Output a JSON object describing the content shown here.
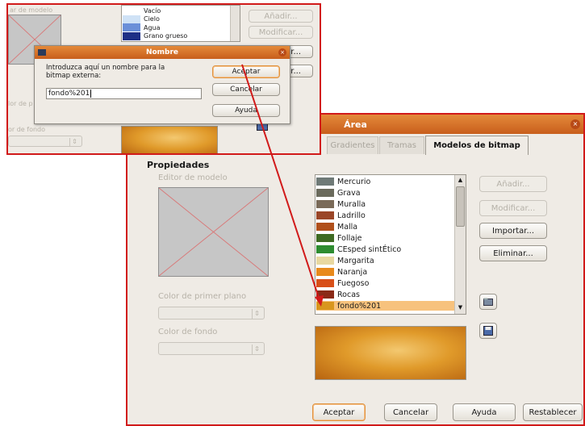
{
  "top_window": {
    "list_items": [
      {
        "label": "Vacío",
        "color": "#ffffff"
      },
      {
        "label": "Cielo",
        "color": "#cfe2f6"
      },
      {
        "label": "Agua",
        "color": "#6a8fd8"
      },
      {
        "label": "Grano grueso",
        "color": "#1e2f86"
      }
    ],
    "editor_label": "ar de modelo",
    "side_buttons": [
      "Añadir...",
      "Modificar...",
      "ortar...",
      "inar..."
    ],
    "left_labels": [
      "lor de p",
      "or de fondo"
    ],
    "dialog": {
      "title": "Nombre",
      "prompt": "Introduzca aquí un nombre para la bitmap externa:",
      "input_value": "fondo%201",
      "accept": "Aceptar",
      "cancel": "Cancelar",
      "help": "Ayuda"
    }
  },
  "area_dialog": {
    "title": "Área",
    "tabs": [
      {
        "label": "Gradientes",
        "active": false
      },
      {
        "label": "Tramas",
        "active": false
      },
      {
        "label": "Modelos de bitmap",
        "active": true
      }
    ],
    "section_label": "Propiedades",
    "editor_label": "Editor de modelo",
    "fg_color_label": "Color de primer plano",
    "bg_color_label": "Color de fondo",
    "bitmaps": [
      {
        "label": "Mercurio",
        "color": "#6f7a77"
      },
      {
        "label": "Grava",
        "color": "#6a6a5c"
      },
      {
        "label": "Muralla",
        "color": "#7a6a58"
      },
      {
        "label": "Ladrillo",
        "color": "#9a4628"
      },
      {
        "label": "Malla",
        "color": "#b0501c"
      },
      {
        "label": "Follaje",
        "color": "#3e6a22"
      },
      {
        "label": "CEsped sintÉtico",
        "color": "#2e8c30"
      },
      {
        "label": "Margarita",
        "color": "#e8d8a0"
      },
      {
        "label": "Naranja",
        "color": "#e88a1c"
      },
      {
        "label": "Fuegoso",
        "color": "#d8501a"
      },
      {
        "label": "Rocas",
        "color": "#8a2a18"
      },
      {
        "label": "fondo%201",
        "color": "#d8961e",
        "selected": true
      }
    ],
    "buttons": {
      "add": "Añadir...",
      "modify": "Modificar...",
      "import": "Importar...",
      "delete": "Eliminar..."
    },
    "footer": {
      "accept": "Aceptar",
      "cancel": "Cancelar",
      "help": "Ayuda",
      "reset": "Restablecer"
    }
  },
  "colors": {
    "annotation_red": "#d11a1a",
    "title_orange": "#d8702a",
    "selection": "#f7c27d"
  }
}
